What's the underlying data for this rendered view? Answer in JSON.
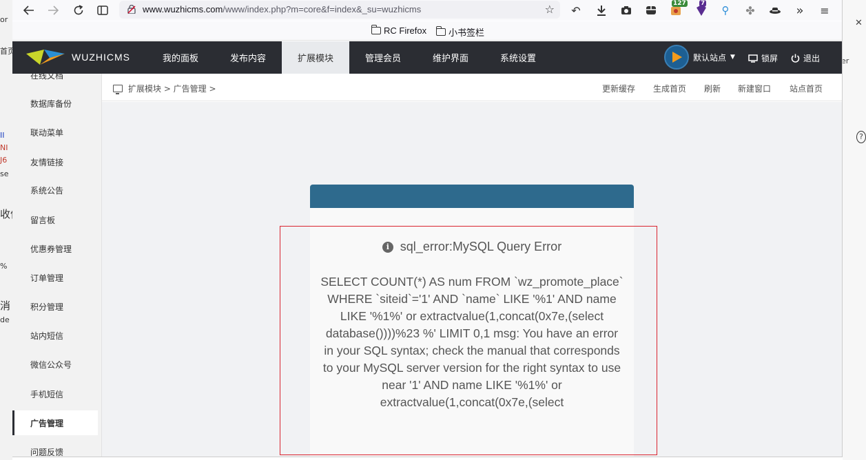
{
  "browser": {
    "url_host": "www.wuzhicms.com",
    "url_path": "/www/index.php?m=core&f=index&_su=wuzhicms",
    "badges": [
      "127",
      "7"
    ],
    "bookmarks": [
      "RC Firefox",
      "小书签栏"
    ]
  },
  "app": {
    "logo_text": "WUZHICMS",
    "nav": [
      "我的面板",
      "发布内容",
      "扩展模块",
      "管理会员",
      "维护界面",
      "系统设置"
    ],
    "active_nav": "扩展模块",
    "site_switch": "默认站点",
    "lock_label": "锁屏",
    "logout_label": "退出"
  },
  "sidebar": {
    "items": [
      "在线文档",
      "数据库备份",
      "联动菜单",
      "友情链接",
      "系统公告",
      "留言板",
      "优惠券管理",
      "订单管理",
      "积分管理",
      "站内短信",
      "微信公众号",
      "手机短信",
      "广告管理",
      "问题反馈"
    ],
    "active": "广告管理"
  },
  "breadcrumb": {
    "text": "扩展模块 > 广告管理 >",
    "actions": [
      "更新缓存",
      "生成首页",
      "刷新",
      "新建窗口",
      "站点首页"
    ]
  },
  "error": {
    "title": "sql_error:MySQL Query Error",
    "message": "SELECT COUNT(*) AS num FROM `wz_promote_place` WHERE `siteid`='1' AND `name` LIKE '%1' AND name LIKE '%1%' or extractvalue(1,concat(0x7e,(select database())))%23 %' LIMIT 0,1 msg: You have an error in your SQL syntax; check the manual that corresponds to your MySQL server version for the right syntax to use near '1' AND name LIKE '%1%' or extractvalue(1,concat(0x7e,(select"
  },
  "background": {
    "left_fragments": [
      "or",
      "首页",
      "II",
      "NI",
      "J6",
      "se",
      "收信",
      "%",
      "消",
      "de"
    ],
    "right_fragments": [
      "er"
    ]
  },
  "colors": {
    "header_bg": "#2b2d33",
    "card_header": "#2e6a8d",
    "highlight_border": "#d9232e"
  }
}
